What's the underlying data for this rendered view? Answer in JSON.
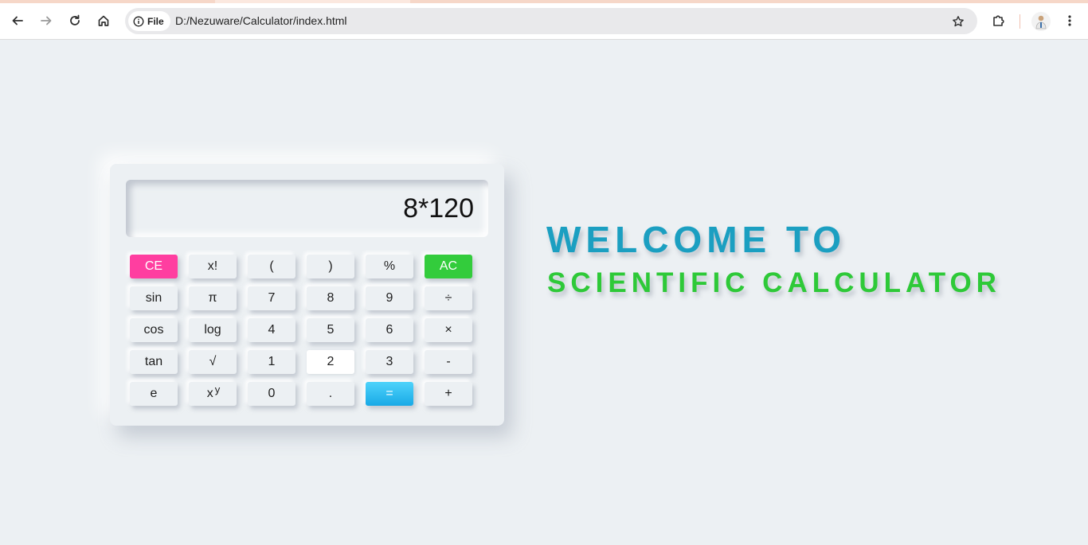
{
  "browser": {
    "site_chip_label": "File",
    "url": "D:/Nezuware/Calculator/index.html",
    "icons": {
      "back": "arrow-left-icon",
      "forward": "arrow-right-icon",
      "reload": "reload-icon",
      "home": "home-icon",
      "info": "info-icon",
      "bookmark": "star-icon",
      "extensions": "puzzle-icon",
      "profile": "avatar",
      "menu": "kebab-menu-icon"
    }
  },
  "calculator": {
    "display_value": "8*120",
    "keys": {
      "ce": "CE",
      "fact": "x!",
      "lparen": "(",
      "rparen": ")",
      "percent": "%",
      "ac": "AC",
      "sin": "sin",
      "pi": "π",
      "seven": "7",
      "eight": "8",
      "nine": "9",
      "divide": "÷",
      "cos": "cos",
      "log": "log",
      "four": "4",
      "five": "5",
      "six": "6",
      "multiply": "×",
      "tan": "tan",
      "sqrt": "√",
      "one": "1",
      "two": "2",
      "three": "3",
      "minus": "-",
      "e": "e",
      "pow_base": "x",
      "pow_exp": "y",
      "zero": "0",
      "dot": ".",
      "equals": "=",
      "plus": "+"
    },
    "colors": {
      "ce": "#ff3ea0",
      "ac": "#33cc3c",
      "equals": "#18a9e6",
      "background": "#ecf0f3"
    }
  },
  "welcome": {
    "line1": "WELCOME TO",
    "line2": "SCIENTIFIC CALCULATOR",
    "line1_color": "#1b9fc1",
    "line2_color": "#2ec938"
  }
}
